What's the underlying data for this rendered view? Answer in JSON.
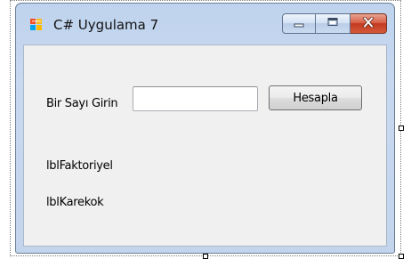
{
  "window": {
    "title": "C# Uygulama 7",
    "caption_buttons": [
      "minimize",
      "maximize",
      "close"
    ]
  },
  "form": {
    "prompt_label": "Bir Sayı Girin",
    "number_input": {
      "value": "",
      "placeholder": ""
    },
    "calculate_button": "Hesapla",
    "factorial_label": "lblFaktoriyel",
    "sqrt_label": "lblKarekok"
  },
  "colors": {
    "title_bar": "#c3d5ec",
    "client_area": "#f0f0f0",
    "close_button": "#c8432a"
  },
  "icons": {
    "app": "windows-form-icon",
    "minimize": "minimize-icon",
    "maximize": "maximize-icon",
    "close": "close-icon"
  }
}
